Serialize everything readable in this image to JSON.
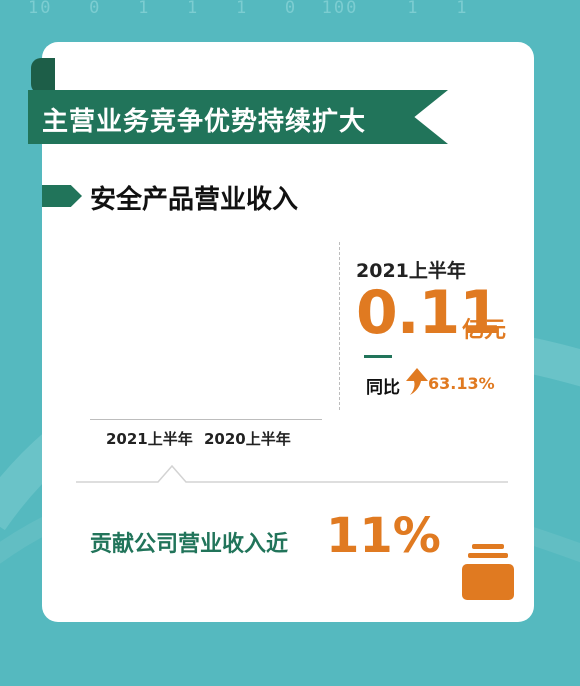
{
  "background": {
    "digits": "10   0   1   1   1   0  100    1   1",
    "color": "#55b9bf"
  },
  "banner": {
    "title": "主营业务竞争优势持续扩大"
  },
  "section": {
    "title": "安全产品营业收入"
  },
  "stat": {
    "period": "2021上半年",
    "value": "0.11",
    "unit": "亿元",
    "yoy_label": "同比",
    "yoy_value": "63.13%"
  },
  "chart_data": {
    "type": "bar",
    "categories": [
      "2021上半年",
      "2020上半年"
    ]
  },
  "contribution": {
    "label": "贡献公司营业收入近",
    "value": "11%"
  },
  "colors": {
    "accent_green": "#21745a",
    "accent_orange": "#e07a21"
  },
  "icons": [
    "arrow-up-icon",
    "coin-stack-icon",
    "arrow-marker-icon"
  ]
}
